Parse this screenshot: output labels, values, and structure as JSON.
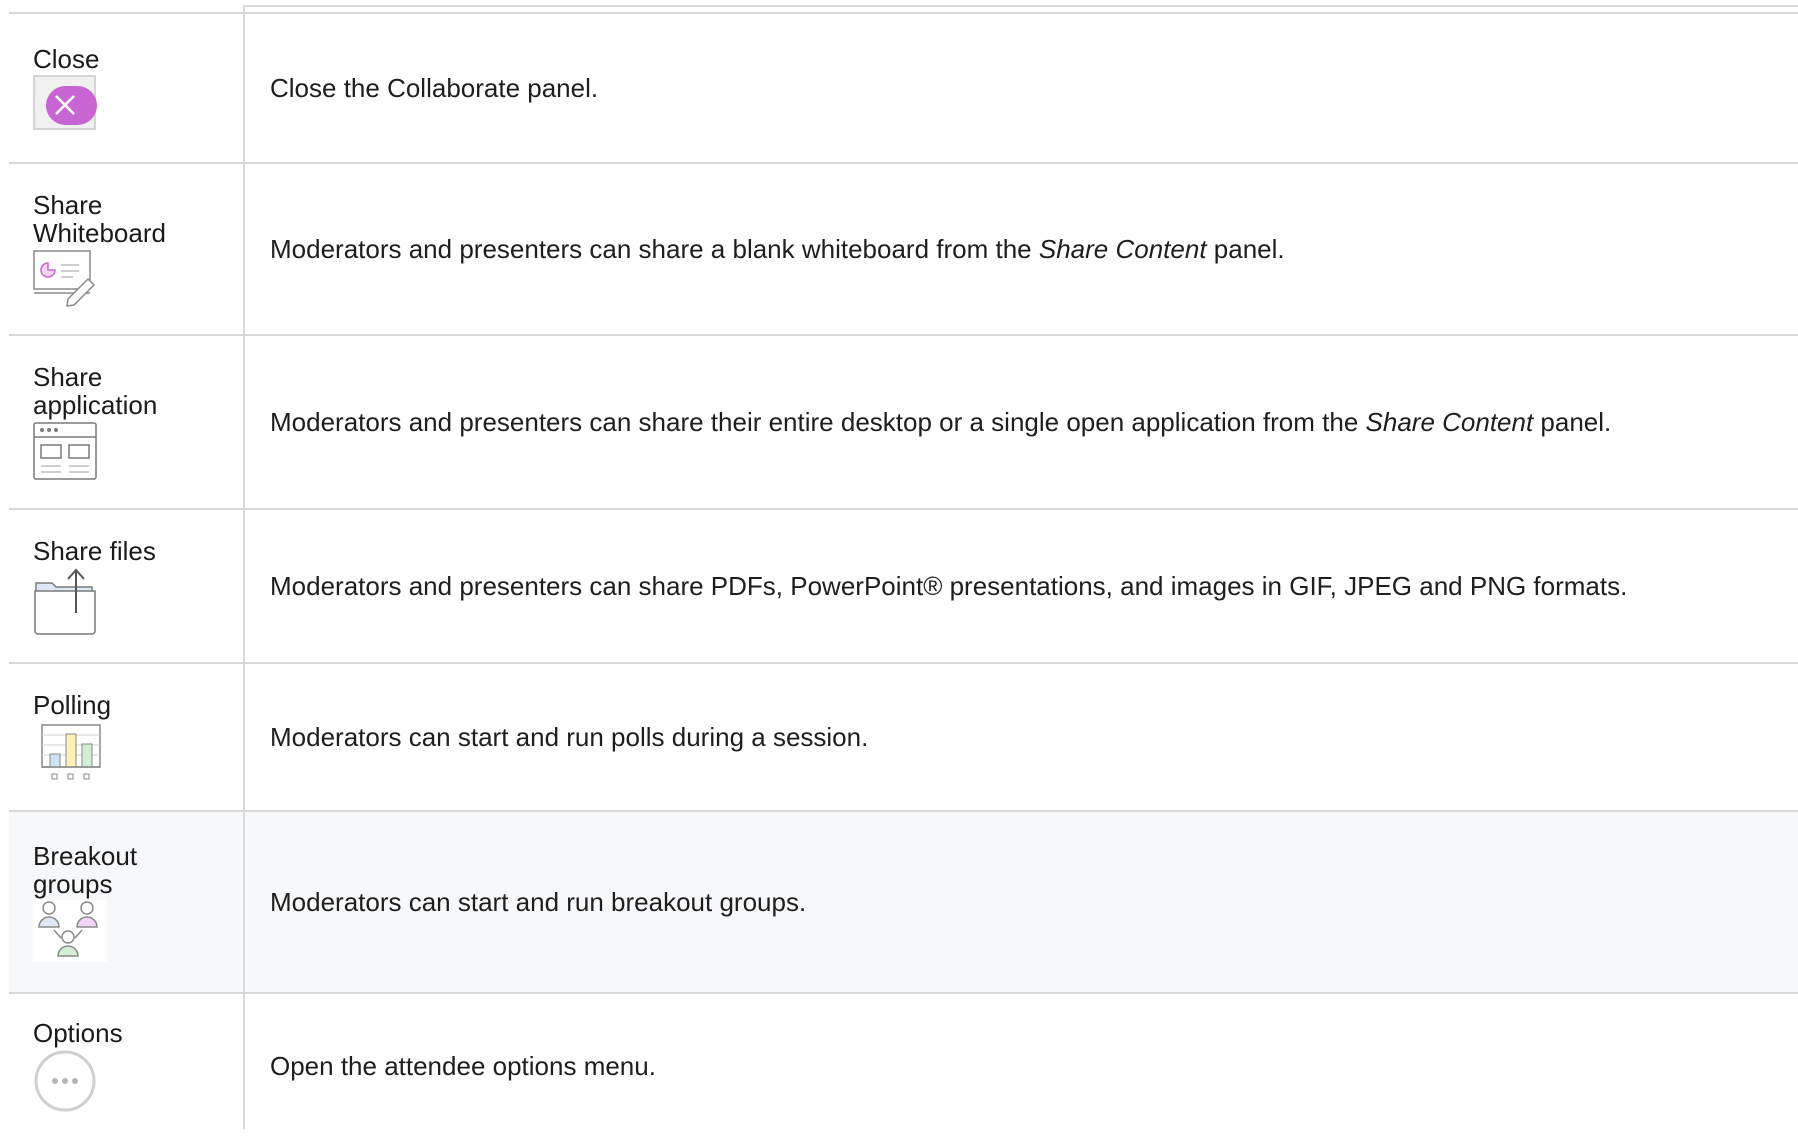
{
  "rows": [
    {
      "label": "Close",
      "icon": "close-icon",
      "desc_before": "Close the Collaborate panel.",
      "desc_italic": "",
      "desc_after": ""
    },
    {
      "label": "Share Whiteboard",
      "icon": "whiteboard-icon",
      "desc_before": "Moderators and presenters can share a blank whiteboard from the ",
      "desc_italic": "Share Content",
      "desc_after": " panel."
    },
    {
      "label": "Share application",
      "icon": "application-window-icon",
      "desc_before": "Moderators and presenters can share their entire desktop or a single open application from the ",
      "desc_italic": "Share Content",
      "desc_after": " panel."
    },
    {
      "label": "Share files",
      "icon": "folder-upload-icon",
      "desc_before": "Moderators and presenters can share PDFs, PowerPoint® presentations, and images in GIF, JPEG and PNG formats.",
      "desc_italic": "",
      "desc_after": ""
    },
    {
      "label": "Polling",
      "icon": "poll-chart-icon",
      "desc_before": "Moderators can start and run polls during a session.",
      "desc_italic": "",
      "desc_after": ""
    },
    {
      "label": "Breakout groups",
      "icon": "breakout-groups-icon",
      "desc_before": "Moderators can start and run breakout groups.",
      "desc_italic": "",
      "desc_after": ""
    },
    {
      "label": "Options",
      "icon": "options-ellipsis-icon",
      "desc_before": "Open the attendee options menu.",
      "desc_italic": "",
      "desc_after": ""
    }
  ],
  "colors": {
    "close_accent": "#c766d2",
    "border": "#d9d9d9",
    "highlight_row": "#f7f8fa",
    "text": "#1e1e1e"
  }
}
